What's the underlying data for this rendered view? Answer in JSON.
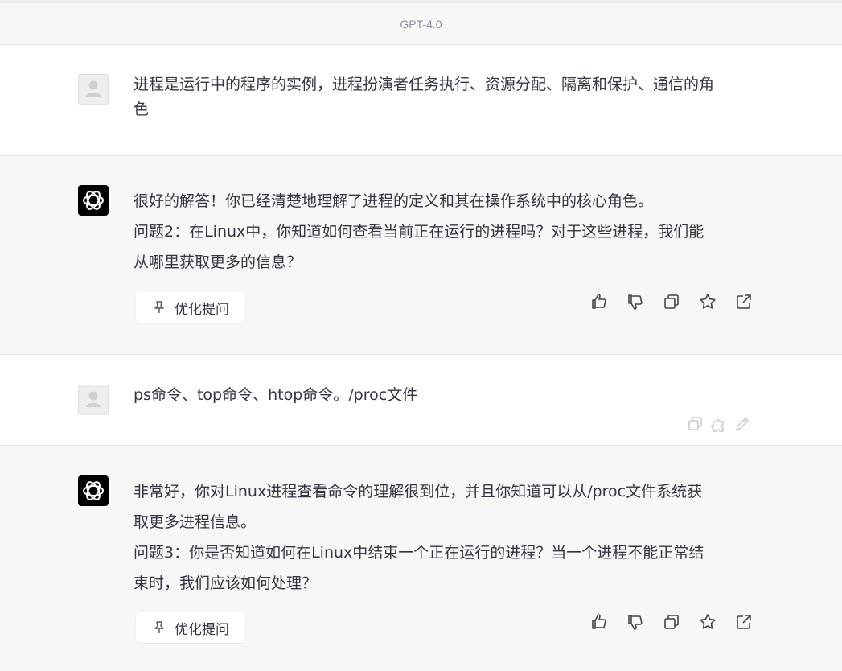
{
  "header": {
    "model_label": "GPT-4.0"
  },
  "messages": [
    {
      "role": "user",
      "lines": [
        "进程是运行中的程序的实例，进程扮演者任务执行、资源分配、隔离和保护、通信的角",
        "色"
      ]
    },
    {
      "role": "assistant",
      "lines": [
        "很好的解答！你已经清楚地理解了进程的定义和其在操作系统中的核心角色。",
        "问题2：在Linux中，你知道如何查看当前正在运行的进程吗？对于这些进程，我们能",
        "从哪里获取更多的信息？"
      ],
      "button": "优化提问"
    },
    {
      "role": "user",
      "lines": [
        "ps命令、top命令、htop命令。/proc文件"
      ]
    },
    {
      "role": "assistant",
      "lines": [
        "非常好，你对Linux进程查看命令的理解很到位，并且你知道可以从/proc文件系统获",
        "取更多进程信息。",
        "问题3：你是否知道如何在Linux中结束一个正在运行的进程？当一个进程不能正常结",
        "束时，我们应该如何处理？"
      ],
      "button": "优化提问"
    }
  ],
  "icons": {
    "assistant_avatar": "openai-logo-icon",
    "user_avatar": "user-silhouette-icon",
    "assistant_actions": [
      "thumbs-up-icon",
      "thumbs-down-icon",
      "copy-icon",
      "star-icon",
      "share-icon"
    ],
    "user_actions": [
      "copy-icon",
      "puzzle-icon",
      "edit-pencil-icon"
    ],
    "optimize": "pin-icon"
  }
}
